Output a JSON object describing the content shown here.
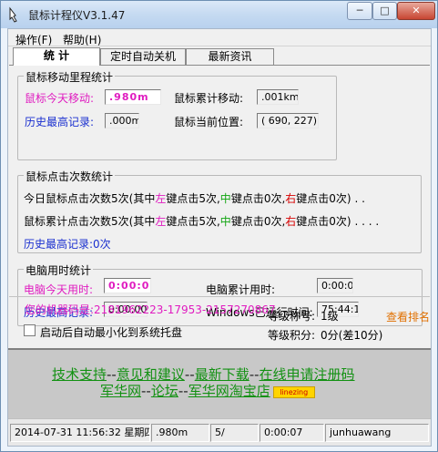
{
  "window": {
    "title": "鼠标计程仪V3.1.47"
  },
  "menu": {
    "operate": "操作(F)",
    "help": "帮助(H)"
  },
  "tabs": [
    {
      "label": "统  计",
      "active": true
    },
    {
      "label": "定时自动关机",
      "active": false
    },
    {
      "label": "最新资讯",
      "active": false
    }
  ],
  "mileage": {
    "legend": "鼠标移动里程统计",
    "today_label": "鼠标今天移动:",
    "today_value": ".980m",
    "record_label": "历史最高记录:",
    "record_value": ".000m",
    "total_label": "鼠标累计移动:",
    "total_value": ".001km",
    "position_label": "鼠标当前位置:",
    "position_value": "( 690, 227)"
  },
  "clicks": {
    "legend": "鼠标点击次数统计",
    "today": {
      "prefix": "今日鼠标点击次数5次(其中",
      "left_word": "左",
      "left_text": "键点击5次,",
      "mid_word": "中",
      "mid_text": "键点击0次,",
      "right_word": "右",
      "right_text": "键点击0次)",
      "dots": ". ."
    },
    "total": {
      "prefix": "鼠标累计点击次数5次(其中",
      "left_word": "左",
      "left_text": "键点击5次,",
      "mid_word": "中",
      "mid_text": "键点击0次,",
      "right_word": "右",
      "right_text": "键点击0次)",
      "dots": ". .  .  ."
    },
    "record": "历史最高记录:0次"
  },
  "time": {
    "legend": "电脑用时统计",
    "today_label": "电脑今天用时:",
    "today_value": "0:00:07",
    "record_label": "历史最高记录:",
    "record_value": "0:00:00",
    "total_label": "电脑累计用时:",
    "total_value": "0:00:07",
    "uptime_label": "Windows已运行时间:",
    "uptime_value": "75:44:19"
  },
  "machine": {
    "code_label": "您的机器码是:",
    "code_value": "2181962223-17953-2157270867",
    "level_label": "等级称号:",
    "level_value": "1级",
    "points_label": "等级积分:",
    "points_value": "0分(差10分)",
    "ranking_link": "查看排名",
    "autostart_label": "启动后自动最小化到系统托盘",
    "autostart_checked": false
  },
  "banner": {
    "links1": [
      "技术支持",
      "意见和建议",
      "最新下载",
      "在线申请注册码"
    ],
    "links2": [
      "军华网",
      "论坛",
      "军华网淘宝店"
    ],
    "separator": "--",
    "logo_text": "linezing"
  },
  "status": {
    "datetime": "2014-07-31 11:56:32 星期四",
    "distance": ".980m",
    "clicks": "5/",
    "time": "0:00:07",
    "user": "junhuawang"
  },
  "colors": {
    "pink": "#e01cc0",
    "blue": "#1a2fcf",
    "green": "#12a512",
    "red": "#d60000",
    "orange": "#e07000",
    "link_green": "#129112"
  },
  "icons": {
    "app": "mouse-icon",
    "minimize": "minimize-icon",
    "maximize": "maximize-icon",
    "close": "close-icon"
  }
}
